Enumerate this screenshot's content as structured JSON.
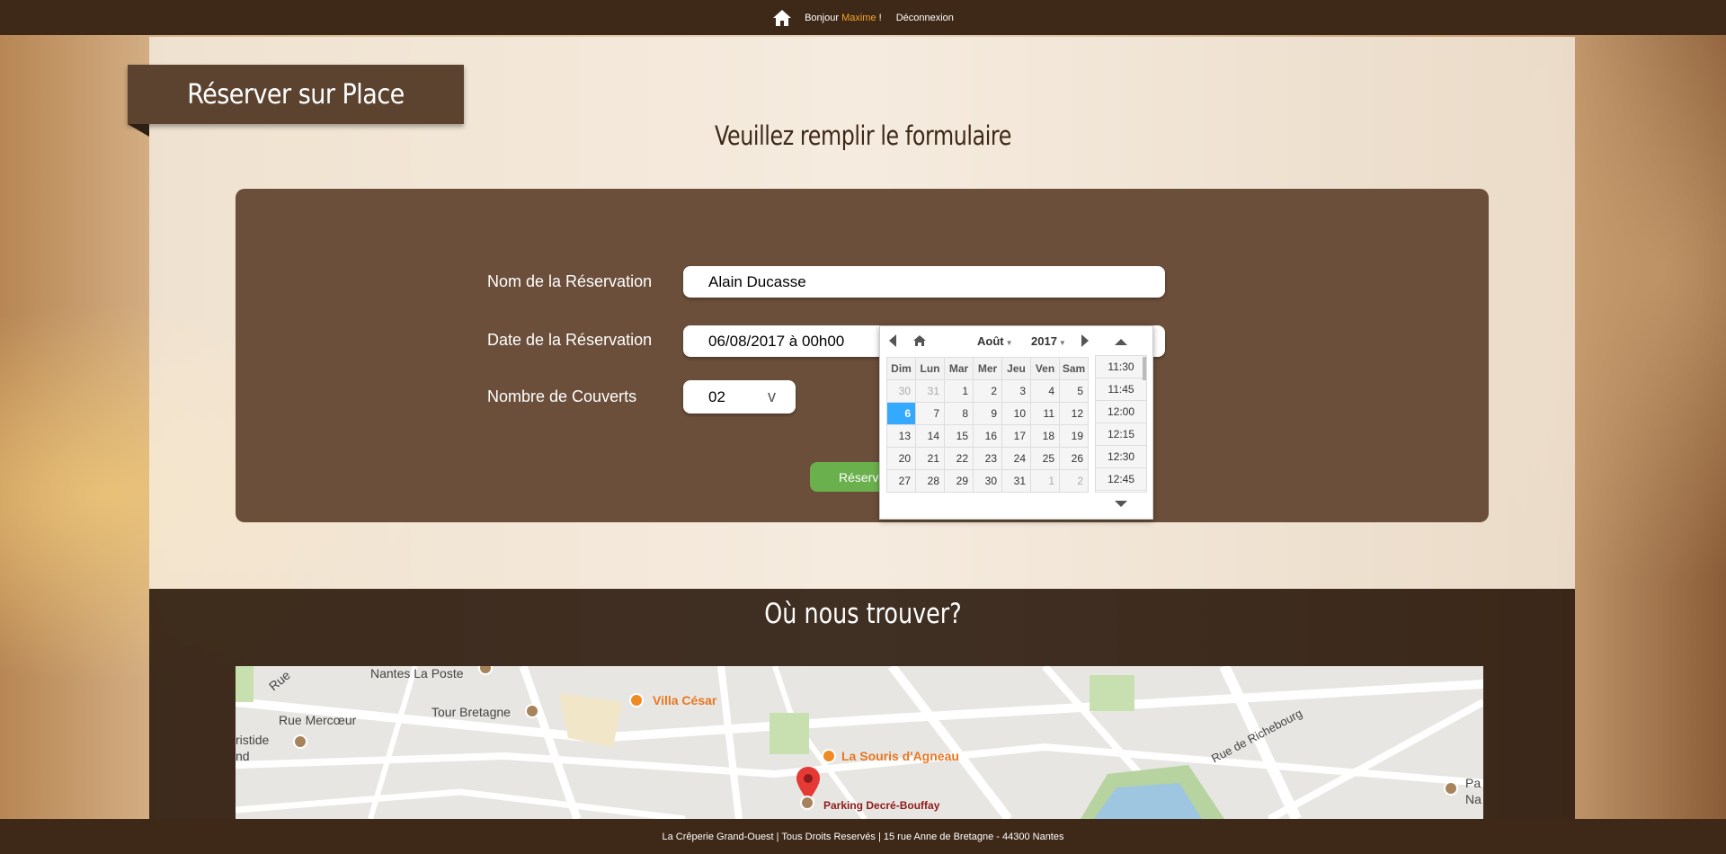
{
  "topbar": {
    "greeting": "Bonjour",
    "username": "Maxime",
    "exclaim": "!",
    "logout": "Déconnexion"
  },
  "page": {
    "ribbon_title": "Réserver sur Place",
    "subtitle": "Veuillez remplir le formulaire"
  },
  "form": {
    "name_label": "Nom de la Réservation",
    "name_value": "Alain Ducasse",
    "date_label": "Date de la Réservation",
    "date_value": "06/08/2017 à 00h00",
    "covers_label": "Nombre de Couverts",
    "covers_value": "02",
    "covers_chevron": "v",
    "submit_label": "Réserve"
  },
  "datepicker": {
    "month": "Août",
    "year": "2017",
    "weekdays": [
      "Dim",
      "Lun",
      "Mar",
      "Mer",
      "Jeu",
      "Ven",
      "Sam"
    ],
    "weeks": [
      [
        "30",
        "31",
        "1",
        "2",
        "3",
        "4",
        "5"
      ],
      [
        "6",
        "7",
        "8",
        "9",
        "10",
        "11",
        "12"
      ],
      [
        "13",
        "14",
        "15",
        "16",
        "17",
        "18",
        "19"
      ],
      [
        "20",
        "21",
        "22",
        "23",
        "24",
        "25",
        "26"
      ],
      [
        "27",
        "28",
        "29",
        "30",
        "31",
        "1",
        "2"
      ]
    ],
    "selected_day": "6",
    "times": [
      "11:30",
      "11:45",
      "12:00",
      "12:15",
      "12:30",
      "12:45"
    ]
  },
  "location": {
    "title": "Où nous trouver?",
    "map_labels": {
      "nantes_poste": "Nantes La Poste",
      "villa_cesar": "Villa César",
      "tour_bretagne": "Tour Bretagne",
      "rue_mercoeur": "Rue Mercœur",
      "ristide": "ristide",
      "nd": "nd",
      "souris": "La Souris d'Agneau",
      "parking": "Parking Decré-Bouffay",
      "richebourg": "Rue de Richebourg",
      "pa": "Pa",
      "na": "Na",
      "rue": "Rue"
    }
  },
  "footer": {
    "text": "La Crêperie Grand-Ouest | Tous Droits Reservés | 15 rue Anne de Bretagne - 44300 Nantes"
  },
  "colors": {
    "dark_brown": "#3e2817",
    "form_brown": "#6b4f3a",
    "accent_orange": "#f5a623",
    "submit_green": "#6ab04c",
    "selected_blue": "#33aaff"
  }
}
